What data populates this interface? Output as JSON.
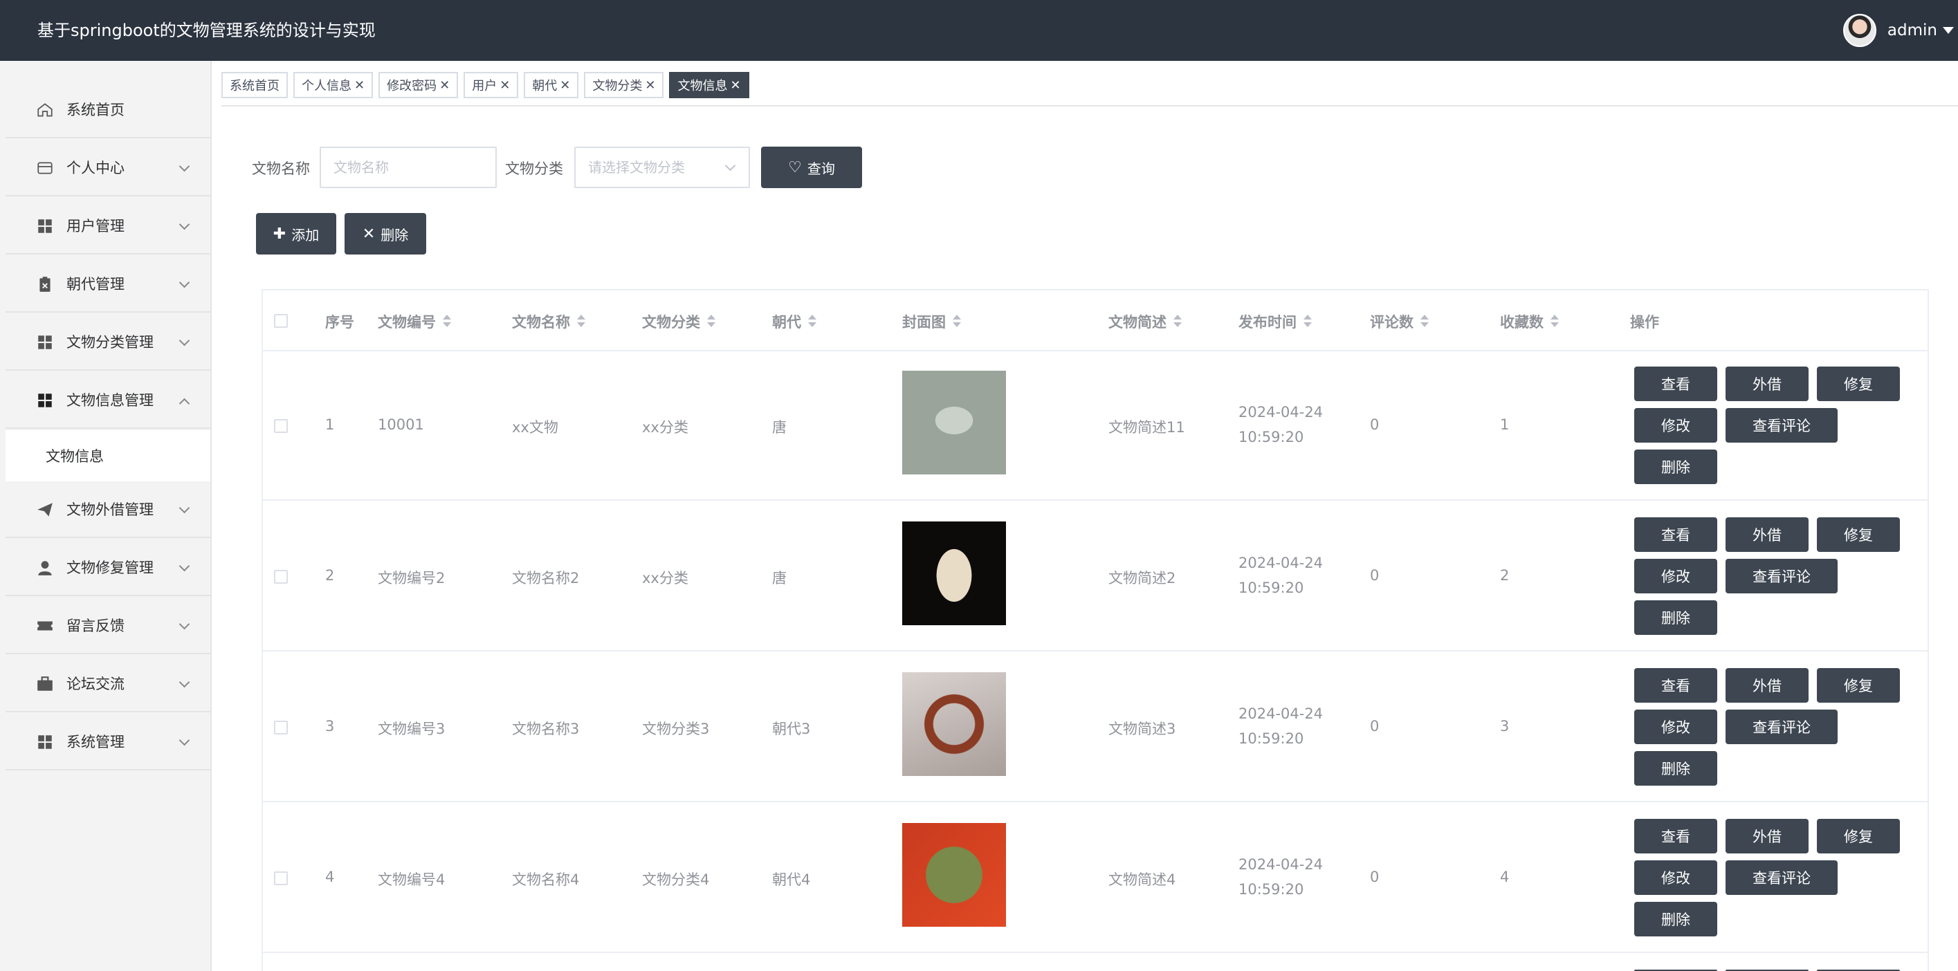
{
  "header": {
    "app_title": "基于springboot的文物管理系统的设计与实现",
    "user_name": "admin"
  },
  "sidebar": {
    "items": [
      {
        "label": "系统首页",
        "icon": "home-icon"
      },
      {
        "label": "个人中心",
        "icon": "id-card-icon"
      },
      {
        "label": "用户管理",
        "icon": "grid-icon"
      },
      {
        "label": "朝代管理",
        "icon": "clipboard-icon"
      },
      {
        "label": "文物分类管理",
        "icon": "grid-icon"
      },
      {
        "label": "文物信息管理",
        "icon": "grid-icon"
      },
      {
        "label": "文物外借管理",
        "icon": "send-icon"
      },
      {
        "label": "文物修复管理",
        "icon": "user-icon"
      },
      {
        "label": "留言反馈",
        "icon": "ticket-icon"
      },
      {
        "label": "论坛交流",
        "icon": "briefcase-icon"
      },
      {
        "label": "系统管理",
        "icon": "grid-icon"
      }
    ],
    "sub_item": "文物信息"
  },
  "tabs": [
    {
      "label": "系统首页",
      "closable": false
    },
    {
      "label": "个人信息",
      "closable": true
    },
    {
      "label": "修改密码",
      "closable": true
    },
    {
      "label": "用户",
      "closable": true
    },
    {
      "label": "朝代",
      "closable": true
    },
    {
      "label": "文物分类",
      "closable": true
    },
    {
      "label": "文物信息",
      "closable": true,
      "active": true
    }
  ],
  "search": {
    "name_label": "文物名称",
    "name_placeholder": "文物名称",
    "category_label": "文物分类",
    "category_placeholder": "请选择文物分类",
    "query_button": "查询"
  },
  "toolbar": {
    "add_button": "添加",
    "delete_button": "删除"
  },
  "table": {
    "headers": {
      "index": "序号",
      "code": "文物编号",
      "name": "文物名称",
      "category": "文物分类",
      "dynasty": "朝代",
      "cover": "封面图",
      "desc": "文物简述",
      "time": "发布时间",
      "comments": "评论数",
      "favorites": "收藏数",
      "ops": "操作"
    },
    "rows": [
      {
        "index": "1",
        "code": "10001",
        "name": "xx文物",
        "category": "xx分类",
        "dynasty": "唐",
        "desc": "文物简述11",
        "time": "2024-04-24 10:59:20",
        "comments": "0",
        "favorites": "1"
      },
      {
        "index": "2",
        "code": "文物编号2",
        "name": "文物名称2",
        "category": "xx分类",
        "dynasty": "唐",
        "desc": "文物简述2",
        "time": "2024-04-24 10:59:20",
        "comments": "0",
        "favorites": "2"
      },
      {
        "index": "3",
        "code": "文物编号3",
        "name": "文物名称3",
        "category": "文物分类3",
        "dynasty": "朝代3",
        "desc": "文物简述3",
        "time": "2024-04-24 10:59:20",
        "comments": "0",
        "favorites": "3"
      },
      {
        "index": "4",
        "code": "文物编号4",
        "name": "文物名称4",
        "category": "文物分类4",
        "dynasty": "朝代4",
        "desc": "文物简述4",
        "time": "2024-04-24 10:59:20",
        "comments": "0",
        "favorites": "4"
      }
    ],
    "op_labels": {
      "view": "查看",
      "lend": "外借",
      "repair": "修复",
      "edit": "修改",
      "view_comments": "查看评论",
      "delete": "删除"
    }
  }
}
